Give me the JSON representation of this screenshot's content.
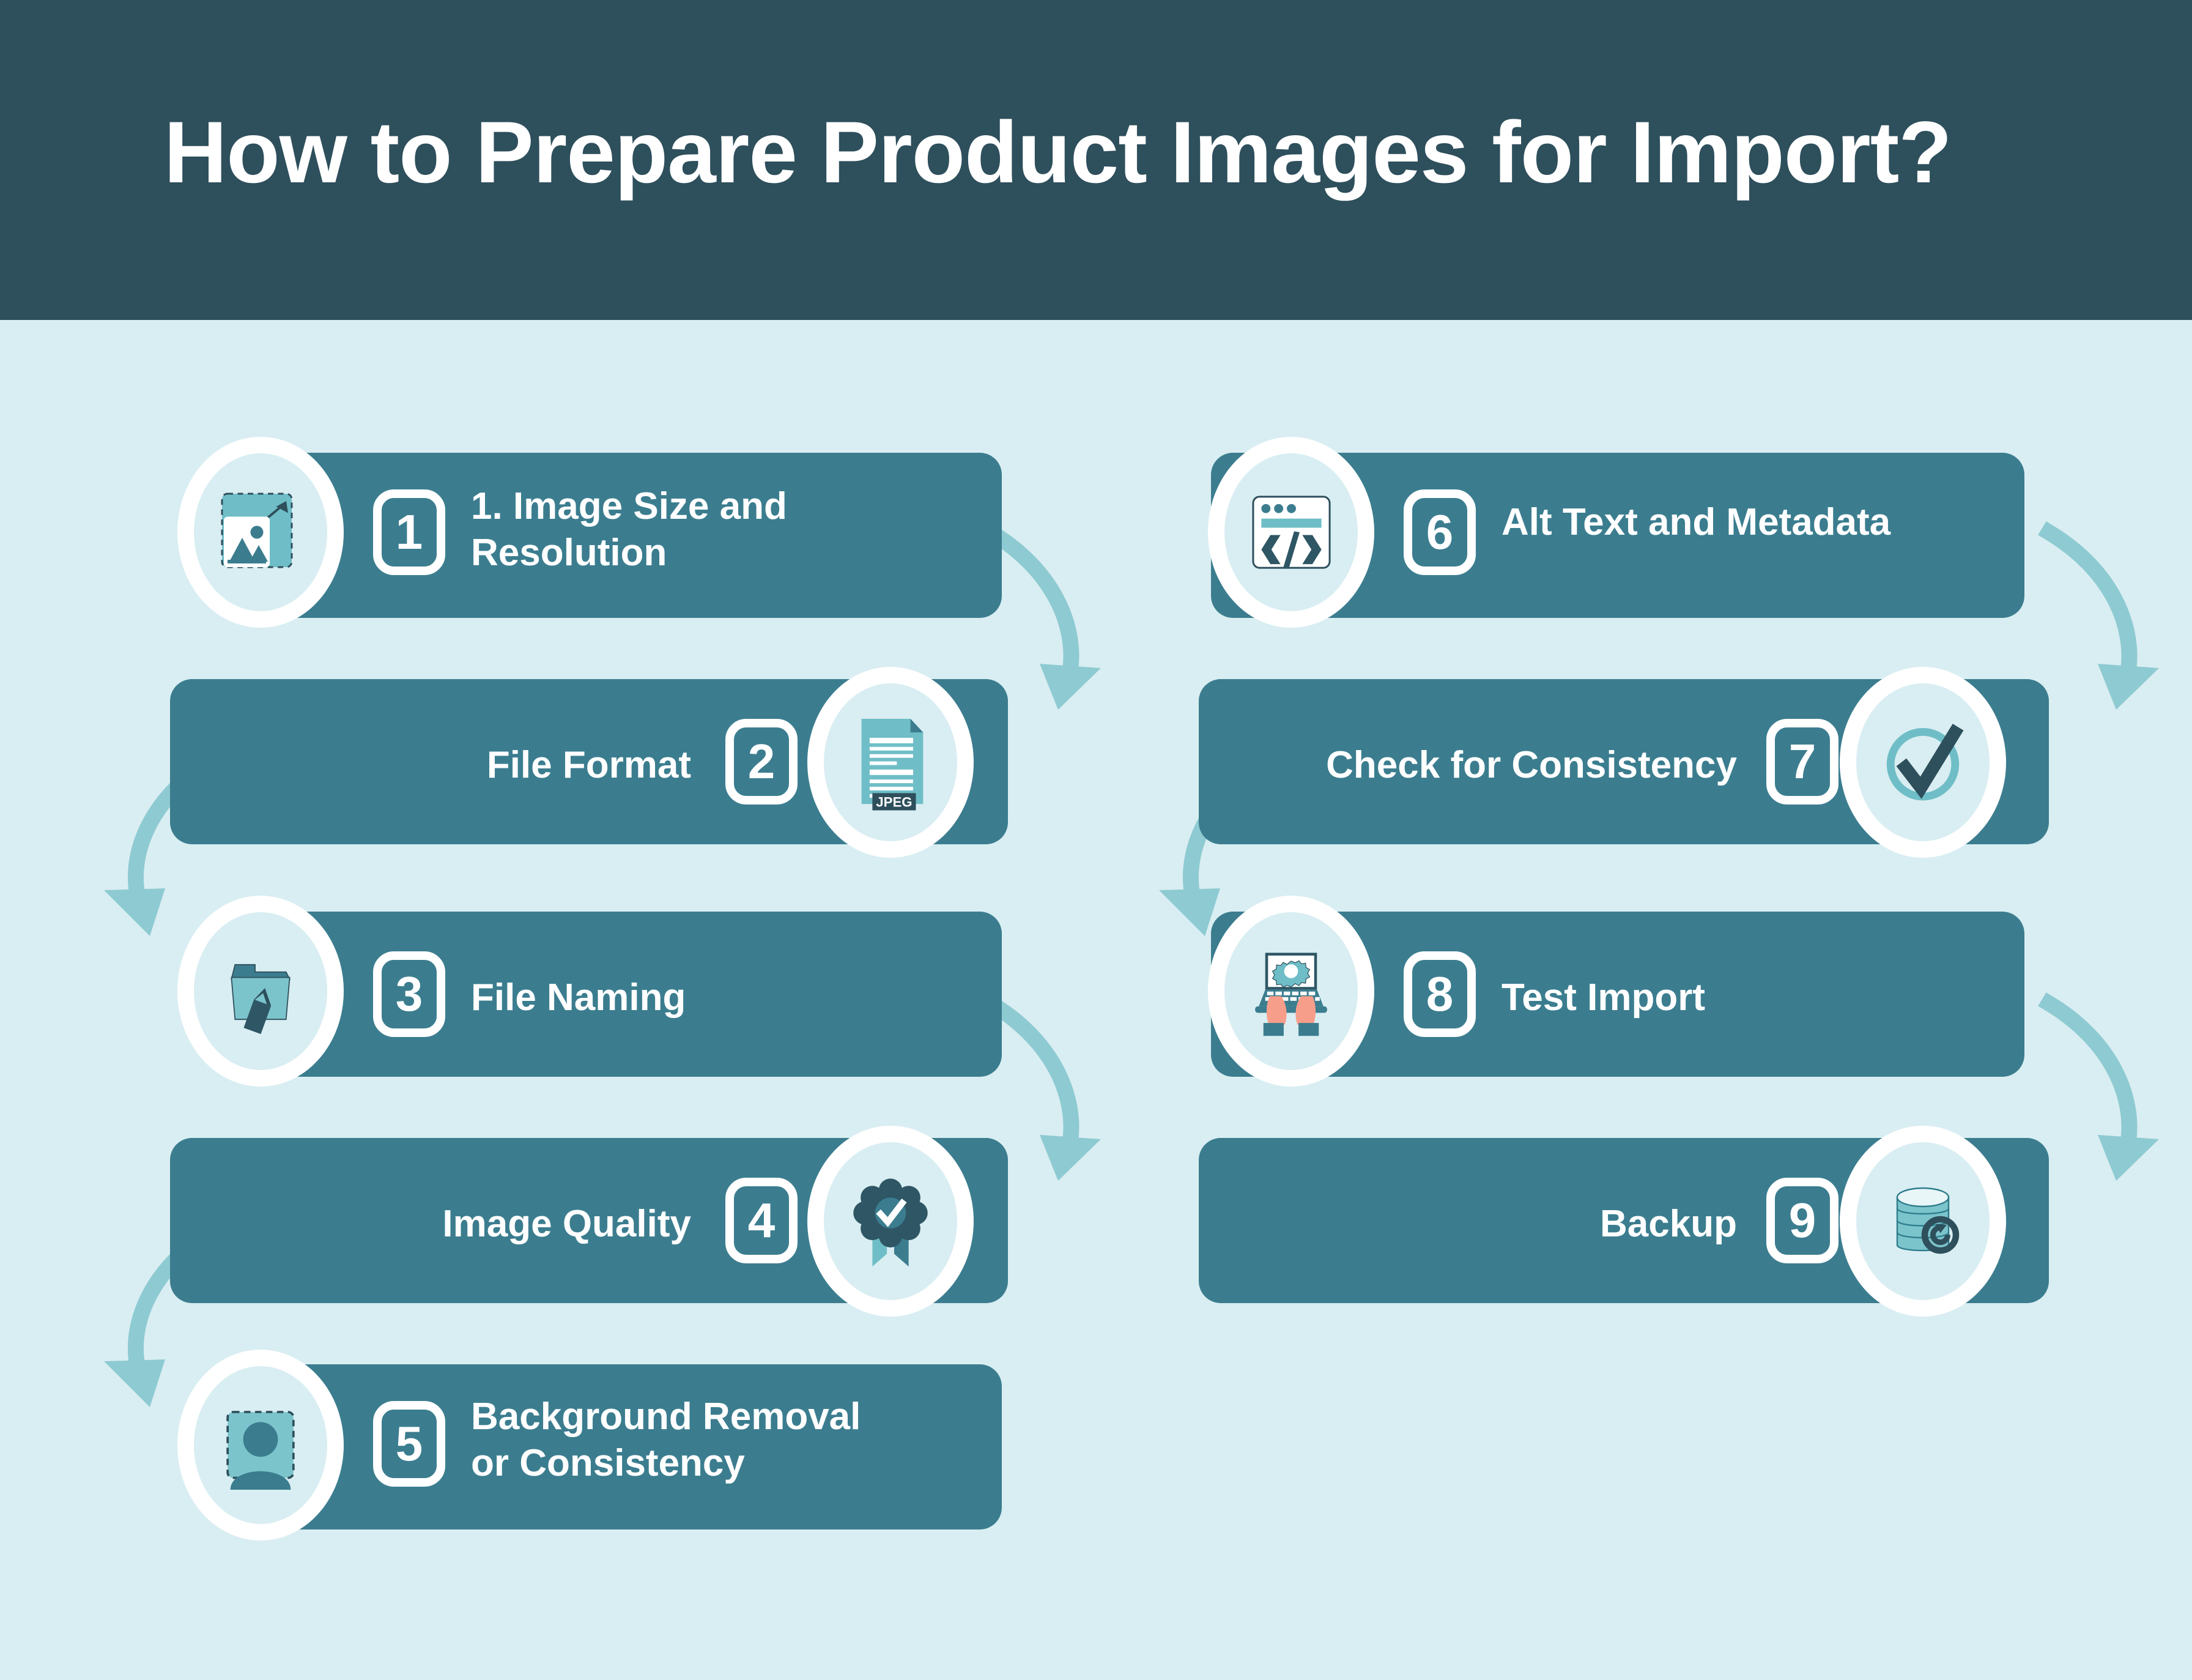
{
  "header": {
    "title": "How to Prepare Product Images for Import?"
  },
  "colors": {
    "header_bg": "#2e4f5c",
    "page_bg": "#d9eef2",
    "bar_bg": "#3b7d8f",
    "accent_teal": "#6fbec7",
    "dark_teal": "#2e4f5c",
    "white": "#ffffff",
    "skin": "#f79e8b"
  },
  "steps": [
    {
      "number": "1",
      "label": "1. Image Size and\nResolution",
      "icon": "image-resize-icon",
      "align": "left",
      "column": "left"
    },
    {
      "number": "2",
      "label": "File Format",
      "icon": "jpeg-document-icon",
      "icon_text": "JPEG",
      "align": "right",
      "column": "left"
    },
    {
      "number": "3",
      "label": "File Naming",
      "icon": "folder-pencil-icon",
      "align": "left",
      "column": "left"
    },
    {
      "number": "4",
      "label": "Image Quality",
      "icon": "award-badge-check-icon",
      "align": "right",
      "column": "left"
    },
    {
      "number": "5",
      "label": "Background Removal\nor Consistency",
      "icon": "person-cutout-icon",
      "align": "left",
      "column": "left"
    },
    {
      "number": "6",
      "label": "Alt Text and Metadata",
      "icon": "code-window-icon",
      "align": "left",
      "column": "right"
    },
    {
      "number": "7",
      "label": "Check for Consistency",
      "icon": "circle-check-icon",
      "align": "right",
      "column": "right"
    },
    {
      "number": "8",
      "label": "Test Import",
      "icon": "laptop-gear-hands-icon",
      "align": "left",
      "column": "right"
    },
    {
      "number": "9",
      "label": "Backup",
      "icon": "database-refresh-icon",
      "align": "right",
      "column": "right"
    }
  ]
}
